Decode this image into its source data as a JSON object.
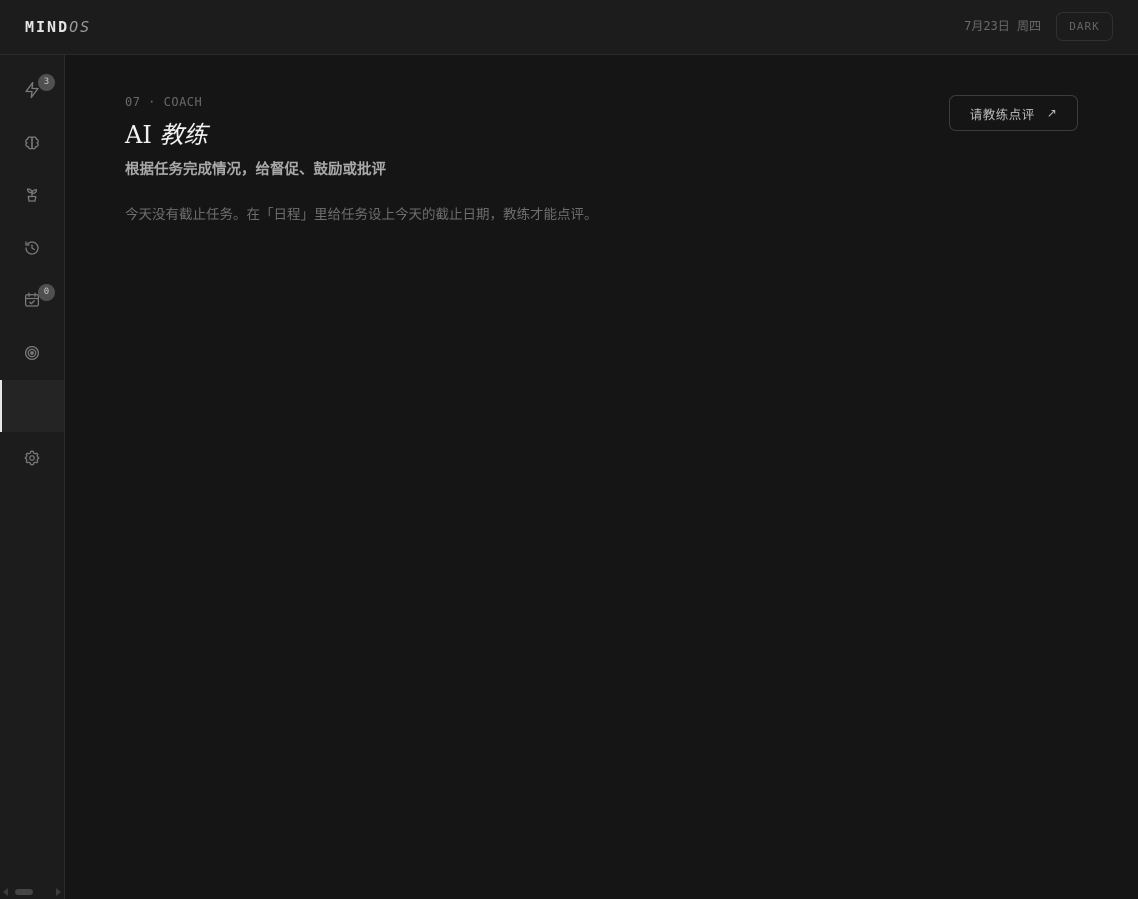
{
  "app": {
    "logo_main": "MIND",
    "logo_accent": "OS",
    "date": "7月23日 周四",
    "theme_toggle": "DARK"
  },
  "sidebar": {
    "items": [
      {
        "icon": "lightning-icon",
        "badge": "3",
        "active": false
      },
      {
        "icon": "brain-icon",
        "badge": null,
        "active": false
      },
      {
        "icon": "sprout-icon",
        "badge": null,
        "active": false
      },
      {
        "icon": "history-icon",
        "badge": null,
        "active": false
      },
      {
        "icon": "calendar-check-icon",
        "badge": "0",
        "active": false
      },
      {
        "icon": "target-icon",
        "badge": null,
        "active": false
      },
      {
        "icon": "coach-icon",
        "badge": null,
        "active": true
      },
      {
        "icon": "settings-icon",
        "badge": null,
        "active": false
      }
    ]
  },
  "main": {
    "eyebrow": "07 · COACH",
    "title_prefix": "AI",
    "title_em": "教练",
    "subtitle": "根据任务完成情况，给督促、鼓励或批评",
    "empty_message": "今天没有截止任务。在「日程」里给任务设上今天的截止日期，教练才能点评。",
    "coach_button_label": "请教练点评",
    "coach_button_icon": "↗"
  },
  "colors": {
    "background": "#151515",
    "panel": "#1c1c1c",
    "text_primary": "#f2f2f2",
    "text_muted": "#6e6e6e",
    "active_indicator": "#e8e8e8"
  }
}
